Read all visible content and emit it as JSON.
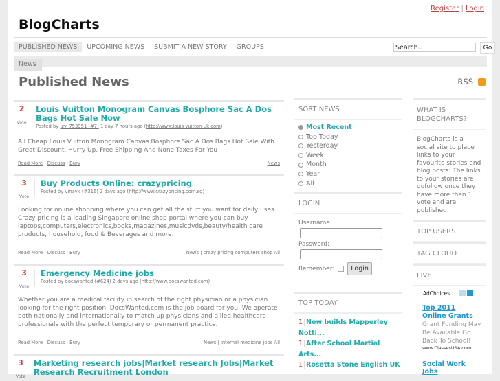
{
  "header": {
    "register": "Register",
    "sep": "|",
    "login": "Login",
    "logo": "BlogCharts"
  },
  "nav": [
    "PUBLISHED NEWS",
    "UPCOMING NEWS",
    "SUBMIT A NEW STORY",
    "GROUPS"
  ],
  "search": {
    "value": "Search..",
    "go": "Go"
  },
  "subnav": {
    "tab": "News"
  },
  "page_title": "Published News",
  "rss": "RSS",
  "stories": [
    {
      "votes": "2",
      "vote_label": "Vote",
      "title": "Louis Vuitton Monogram Canvas Bosphore Sac A Dos Bags Hot Sale Now",
      "posted_by": "Posted by",
      "user": "lzy_753951 (#7)",
      "time": "1 day 7 hours ago",
      "url": "http://www.louis-vuitton-uk.com",
      "desc": "All Cheap Louis Vuitton Monogram Canvas Bosphore Sac A Dos Bags Hot Sale With Great Discount, Hurry Up, Free Shipping And None Taxes For You",
      "read_more": "Read More",
      "discuss": "Discuss",
      "bury": "Bury",
      "tags": "News"
    },
    {
      "votes": "3",
      "vote_label": "Vote",
      "title": "Buy Products Online: crazypricing",
      "posted_by": "Posted by",
      "user": "vinayk (#316)",
      "time": "2 days ago",
      "url": "http://www.crazypricing.com.sg",
      "desc": "Looking for online shopping where you can get all the stuff you want for daily uses. Crazy pricing is a leading Singapore online shop portal where you can buy laptops,computers,electronics,books,magazines,musicdvds,beauty/health care products, household, food & Beverages and more.",
      "read_more": "Read More",
      "discuss": "Discuss",
      "bury": "Bury",
      "tags": "News | crazy pricing computers shop All"
    },
    {
      "votes": "3",
      "vote_label": "Vote",
      "title": "Emergency Medicine jobs",
      "posted_by": "Posted by",
      "user": "docswanted (#624)",
      "time": "2 days ago",
      "url": "http://www.docswanted.com",
      "desc": "Whether you are a medical facility in search of the right physician or a physician looking for the right position, DocsWanted.com is the job board for you. We operate both nationally and internationally to match up physicians and allied healthcare professionals with the perfect temporary or permanent practice.",
      "read_more": "Read More",
      "discuss": "Discuss",
      "bury": "Bury",
      "tags": "News | internal medicine jobs All"
    },
    {
      "votes": "3",
      "vote_label": "Vote",
      "title": "Marketing research jobs|Market research Jobs|Market Research Recruitment London"
    }
  ],
  "sort": {
    "heading": "SORT NEWS",
    "options": [
      "Most Recent",
      "Top Today",
      "Yesterday",
      "Week",
      "Month",
      "Year",
      "All"
    ]
  },
  "login": {
    "heading": "LOGIN",
    "username": "Username:",
    "password": "Password:",
    "remember": "Remember:",
    "button": "Login"
  },
  "top_today": {
    "heading": "TOP TODAY",
    "items": [
      {
        "n": "1",
        "t": "New builds Mapperley Notti..."
      },
      {
        "n": "1",
        "t": "After School Martial Arts..."
      },
      {
        "n": "1",
        "t": "Rosetta Stone English UK"
      }
    ]
  },
  "about": {
    "heading": "WHAT IS BLOGCHARTS?",
    "text": "BlogCharts is a social site to place links to your favourite stories and blog posts: The links to your stories are dofollow once they have more than 1 vote and are published."
  },
  "top_users": "TOP USERS",
  "tag_cloud": "TAG CLOUD",
  "live": "LIVE",
  "ad": {
    "adchoices": "AdChoices",
    "title1": "Top 2011 Online Grants",
    "text1": "Grant Funding May Be Available Go Back To School!",
    "url1": "www.ClassesUSA.com",
    "title2": "Social Work Jobs"
  }
}
